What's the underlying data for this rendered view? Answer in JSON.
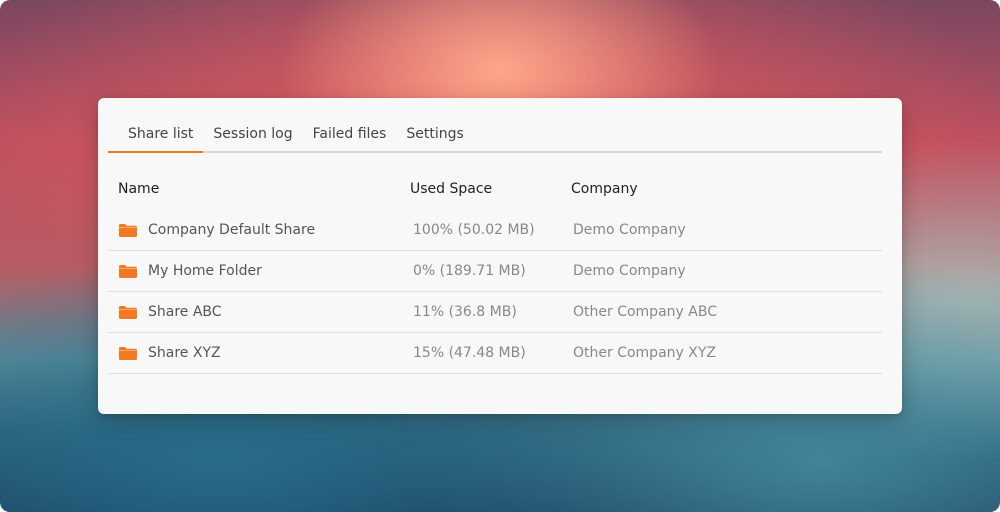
{
  "tabs": [
    {
      "label": "Share list",
      "active": true
    },
    {
      "label": "Session log",
      "active": false
    },
    {
      "label": "Failed files",
      "active": false
    },
    {
      "label": "Settings",
      "active": false
    }
  ],
  "columns": {
    "name": "Name",
    "used_space": "Used Space",
    "company": "Company"
  },
  "rows": [
    {
      "name": "Company Default Share",
      "used_space": "100% (50.02 MB)",
      "company": "Demo Company",
      "icon": "folder-icon"
    },
    {
      "name": "My Home Folder",
      "used_space": "0% (189.71 MB)",
      "company": "Demo Company",
      "icon": "folder-icon"
    },
    {
      "name": "Share ABC",
      "used_space": "11% (36.8 MB)",
      "company": "Other Company ABC",
      "icon": "folder-icon"
    },
    {
      "name": "Share XYZ",
      "used_space": "15% (47.48 MB)",
      "company": "Other Company XYZ",
      "icon": "folder-icon"
    }
  ],
  "colors": {
    "accent": "#f07a23",
    "folder": "#f07a23"
  }
}
